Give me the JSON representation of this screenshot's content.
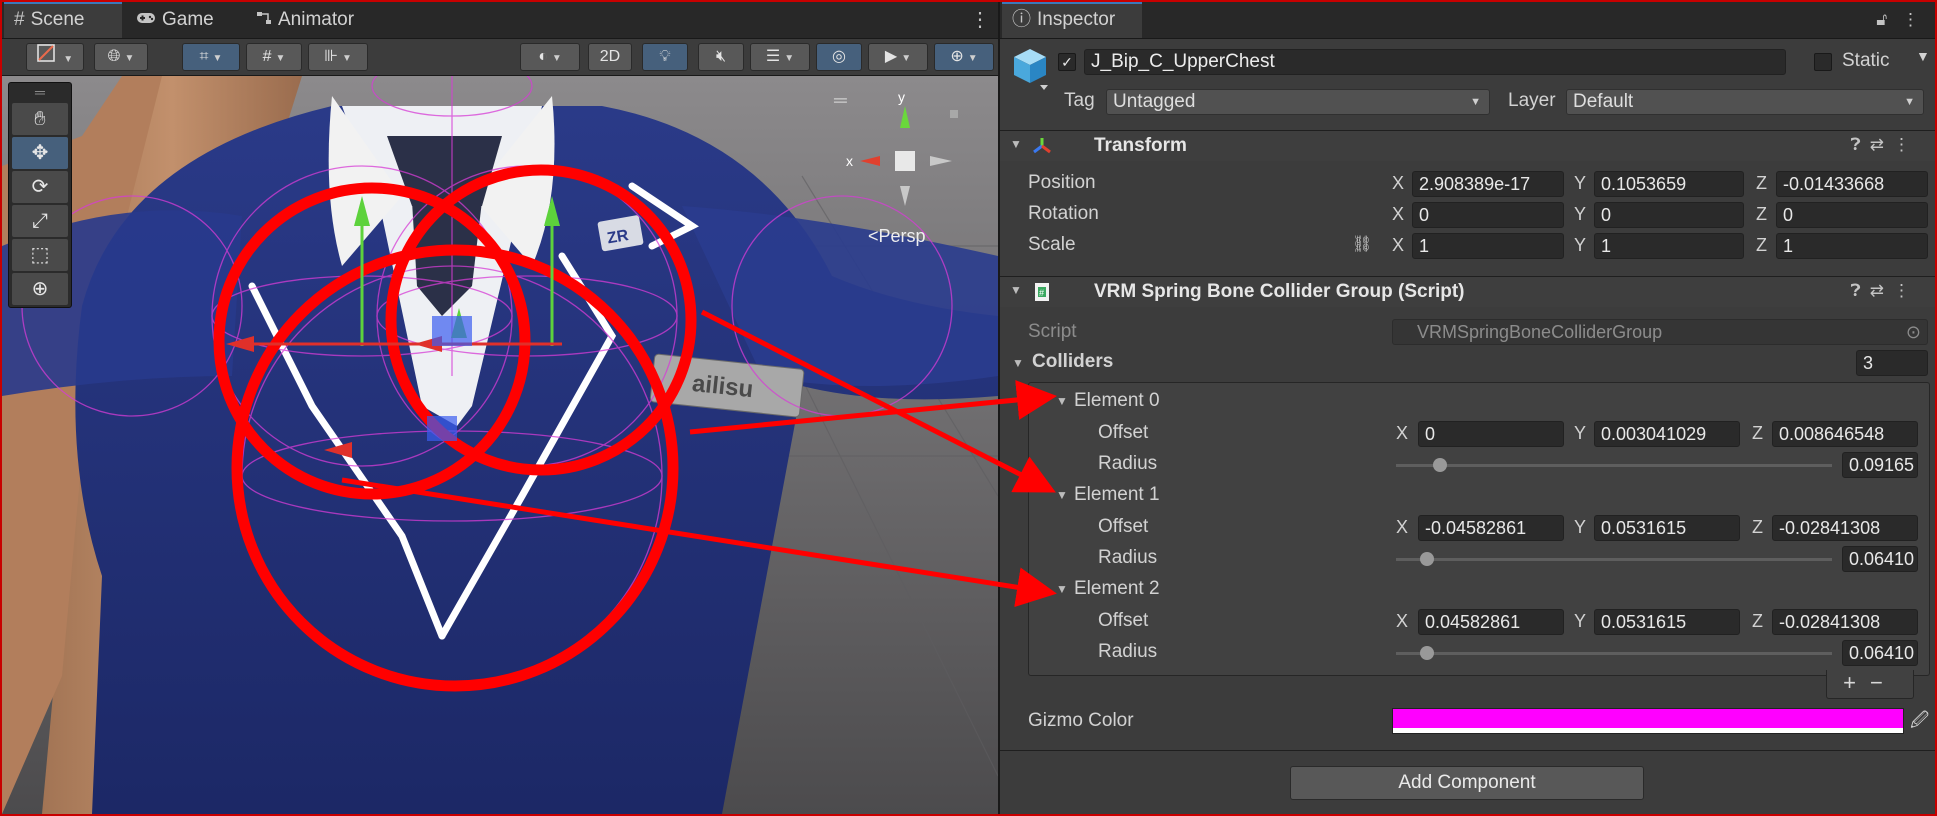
{
  "scene_panel": {
    "tabs": [
      {
        "label": "Scene",
        "icon": "hash-icon"
      },
      {
        "label": "Game",
        "icon": "gamepad-icon"
      },
      {
        "label": "Animator",
        "icon": "animator-icon"
      }
    ],
    "toolbar": {
      "mode_2d_label": "2D"
    },
    "viewport": {
      "projection_label": "<Persp",
      "gizmo_axis_y": "y",
      "gizmo_axis_x": "x",
      "name_badge_text": "ailisu",
      "logo_badge_text": "ZR"
    }
  },
  "inspector": {
    "tab_label": "Inspector",
    "gameobject": {
      "active_checked": true,
      "name": "J_Bip_C_UpperChest",
      "static_label": "Static",
      "static_checked": false,
      "tag_label": "Tag",
      "tag_value": "Untagged",
      "layer_label": "Layer",
      "layer_value": "Default"
    },
    "transform": {
      "title": "Transform",
      "rows": [
        {
          "label": "Position",
          "x": "2.908389e-17",
          "y": "0.1053659",
          "z": "-0.01433668"
        },
        {
          "label": "Rotation",
          "x": "0",
          "y": "0",
          "z": "0"
        },
        {
          "label": "Scale",
          "x": "1",
          "y": "1",
          "z": "1"
        }
      ]
    },
    "collider_group": {
      "title": "VRM Spring Bone Collider Group (Script)",
      "script_label": "Script",
      "script_value": "VRMSpringBoneColliderGroup",
      "colliders_label": "Colliders",
      "colliders_count": "3",
      "offset_label": "Offset",
      "radius_label": "Radius",
      "elements": [
        {
          "label": "Element 0",
          "x": "0",
          "y": "0.003041029",
          "z": "0.008646548",
          "radius": "0.09165",
          "radius_level": 0.1
        },
        {
          "label": "Element 1",
          "x": "-0.04582861",
          "y": "0.0531615",
          "z": "-0.02841308",
          "radius": "0.06410",
          "radius_level": 0.07
        },
        {
          "label": "Element 2",
          "x": "0.04582861",
          "y": "0.0531615",
          "z": "-0.02841308",
          "radius": "0.06410",
          "radius_level": 0.07
        }
      ],
      "gizmo_color_label": "Gizmo Color",
      "gizmo_color": "#ff00ff"
    },
    "add_component_label": "Add Component"
  },
  "axis_letters": {
    "x": "X",
    "y": "Y",
    "z": "Z"
  },
  "colors": {
    "annotation_red": "#ff0000",
    "accent_blue": "#3a79bb",
    "gizmo_magenta": "#ff00ff"
  }
}
